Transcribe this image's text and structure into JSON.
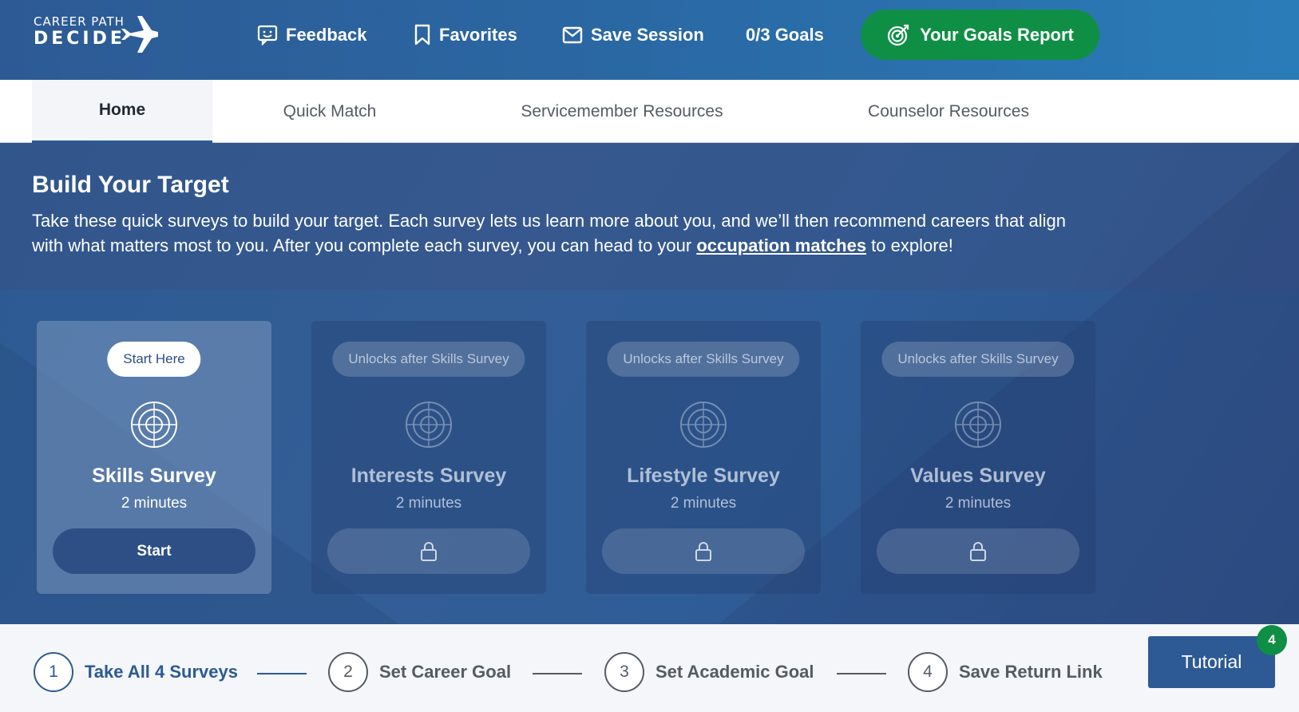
{
  "header": {
    "logo_line1": "CAREER PATH",
    "logo_line2": "DECIDE",
    "feedback": "Feedback",
    "favorites": "Favorites",
    "save_session": "Save Session",
    "goals_count": "0/3 Goals",
    "goals_report": "Your Goals Report"
  },
  "tabs": [
    {
      "label": "Home",
      "active": true
    },
    {
      "label": "Quick Match"
    },
    {
      "label": "Servicemember Resources"
    },
    {
      "label": "Counselor Resources"
    }
  ],
  "hero": {
    "title": "Build Your Target",
    "intro_before": "Take these quick surveys to build your target. Each survey lets us learn more about you, and we’ll then recommend careers that align with what matters most to you. After you complete each survey, you can head to your ",
    "intro_link": "occupation matches",
    "intro_after": " to explore!"
  },
  "surveys": [
    {
      "pill": "Start Here",
      "title": "Skills Survey",
      "duration": "2 minutes",
      "button": "Start",
      "locked": false
    },
    {
      "pill": "Unlocks after Skills Survey",
      "title": "Interests Survey",
      "duration": "2 minutes",
      "locked": true,
      "lock_icon": "lock-icon"
    },
    {
      "pill": "Unlocks after Skills Survey",
      "title": "Lifestyle Survey",
      "duration": "2 minutes",
      "locked": true,
      "lock_icon": "lock-icon"
    },
    {
      "pill": "Unlocks after Skills Survey",
      "title": "Values Survey",
      "duration": "2 minutes",
      "locked": true,
      "lock_icon": "lock-icon"
    }
  ],
  "steps": [
    {
      "num": "1",
      "label": "Take All 4 Surveys"
    },
    {
      "num": "2",
      "label": "Set Career Goal"
    },
    {
      "num": "3",
      "label": "Set Academic Goal"
    },
    {
      "num": "4",
      "label": "Save Return Link"
    }
  ],
  "tutorial": {
    "label": "Tutorial",
    "badge": "4"
  },
  "colors": {
    "brand_blue": "#2d5a94",
    "accent_green": "#0f8f45"
  }
}
